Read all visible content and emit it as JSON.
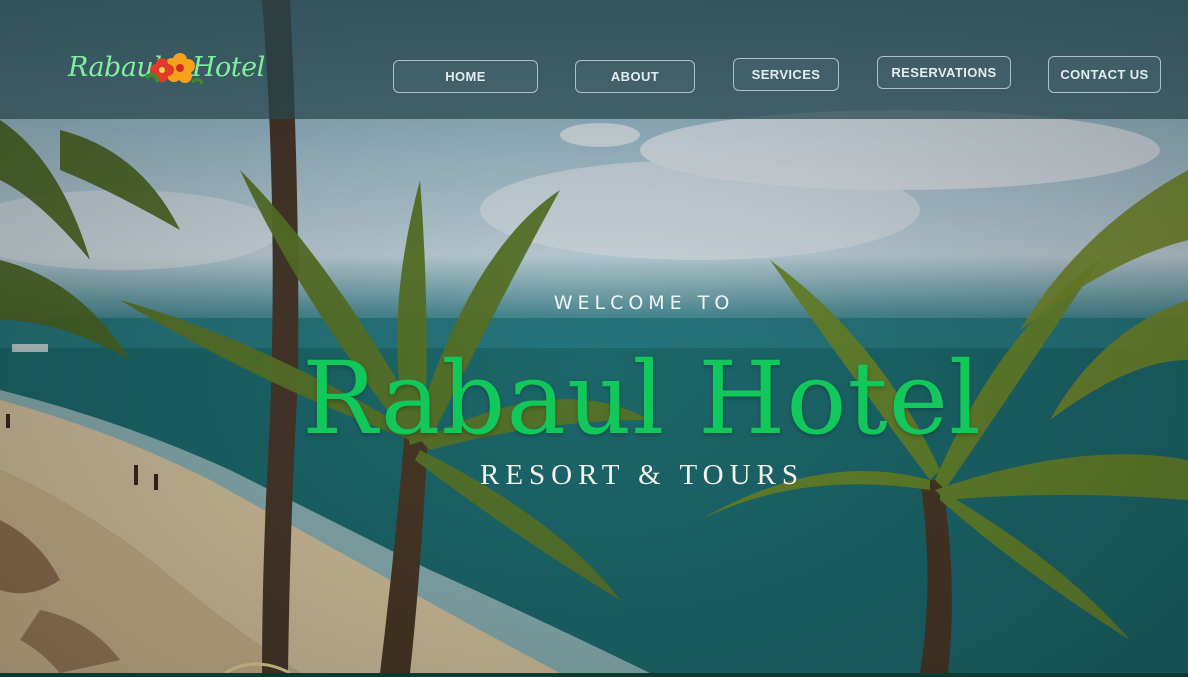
{
  "brand": {
    "logo_part1": "Rabaul",
    "logo_part2": "Hotel",
    "logo_icon": "hibiscus-flower-icon",
    "accent_color": "#12c85a"
  },
  "nav": {
    "items": [
      {
        "label": "HOME"
      },
      {
        "label": "ABOUT"
      },
      {
        "label": "SERVICES"
      },
      {
        "label": "RESERVATIONS"
      },
      {
        "label": "CONTACT US"
      }
    ]
  },
  "hero": {
    "welcome": "WELCOME TO",
    "title": "Rabaul Hotel",
    "subtitle": "RESORT & TOURS"
  }
}
